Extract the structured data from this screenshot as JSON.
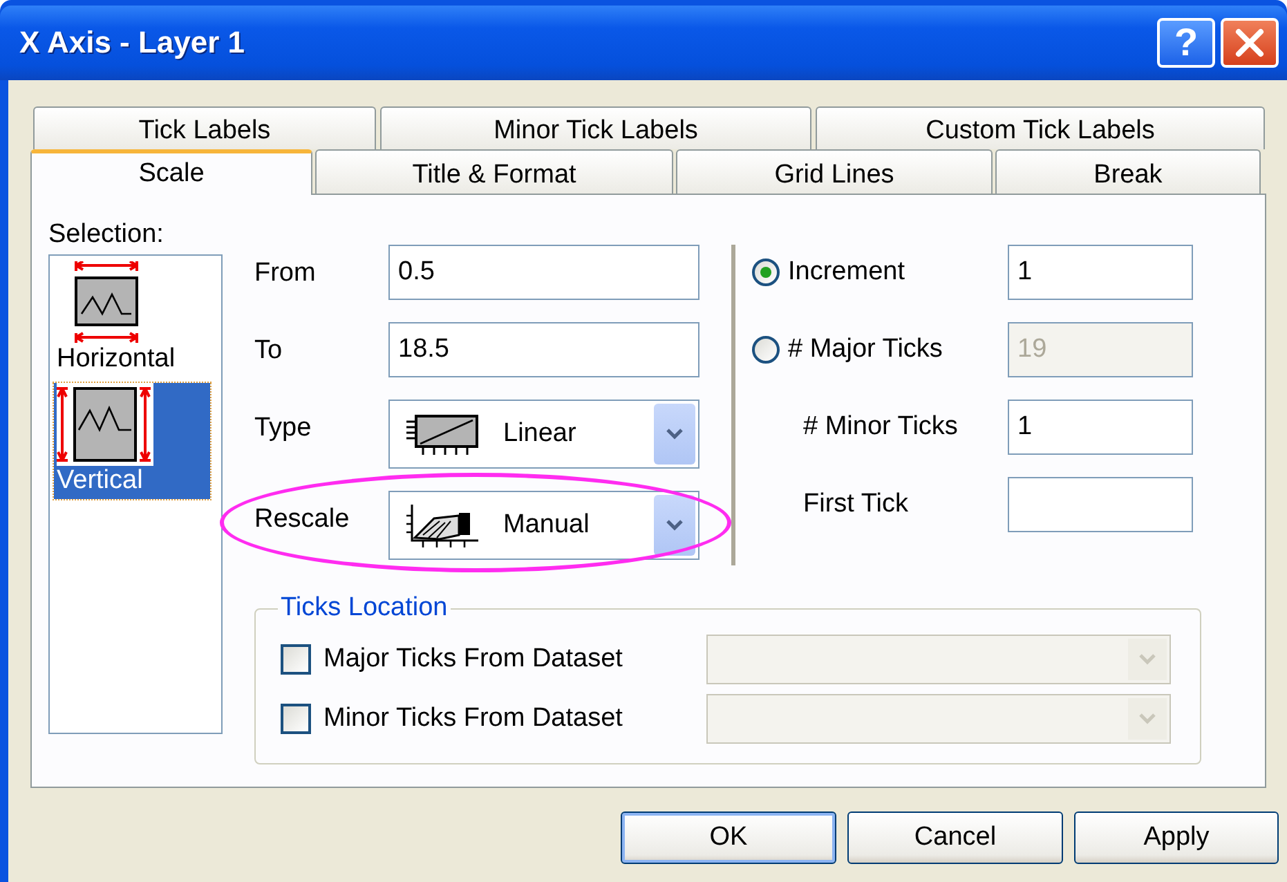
{
  "window": {
    "title": "X Axis - Layer 1",
    "help_button": "?"
  },
  "tab_rows": [
    {
      "tabs": [
        {
          "label": "Tick Labels",
          "selected": false
        },
        {
          "label": "Minor Tick Labels",
          "selected": false
        },
        {
          "label": "Custom Tick Labels",
          "selected": false
        }
      ]
    },
    {
      "tabs": [
        {
          "label": "Scale",
          "selected": true
        },
        {
          "label": "Title & Format",
          "selected": false
        },
        {
          "label": "Grid Lines",
          "selected": false
        },
        {
          "label": "Break",
          "selected": false
        }
      ]
    }
  ],
  "selection": {
    "label": "Selection:",
    "items": [
      {
        "label": "Horizontal",
        "kind": "horizontal",
        "selected": false
      },
      {
        "label": "Vertical",
        "kind": "vertical",
        "selected": true
      }
    ]
  },
  "scale_fields": [
    {
      "label": "From",
      "kind": "text",
      "value": "0.5",
      "highlighted": false
    },
    {
      "label": "To",
      "kind": "text",
      "value": "18.5",
      "highlighted": false
    },
    {
      "label": "Type",
      "kind": "dropdown",
      "value": "Linear",
      "highlighted": false
    },
    {
      "label": "Rescale",
      "kind": "dropdown",
      "value": "Manual",
      "highlighted": true
    }
  ],
  "tick_options": [
    {
      "kind": "radio",
      "label": "Increment",
      "selected": true,
      "value": "1",
      "disabled": false
    },
    {
      "kind": "radio",
      "label": "# Major Ticks",
      "selected": false,
      "value": "19",
      "disabled": true
    },
    {
      "kind": "plain",
      "label": "# Minor Ticks",
      "value": "1",
      "disabled": false
    },
    {
      "kind": "plain",
      "label": "First Tick",
      "disabled": false
    }
  ],
  "ticks_location": {
    "title": "Ticks Location",
    "rows": [
      {
        "label": "Major Ticks From Dataset",
        "checked": false
      },
      {
        "label": "Minor Ticks From Dataset",
        "checked": false
      }
    ]
  },
  "buttons": [
    {
      "label": "OK",
      "default": true
    },
    {
      "label": "Cancel",
      "default": false
    },
    {
      "label": "Apply",
      "default": false
    }
  ]
}
